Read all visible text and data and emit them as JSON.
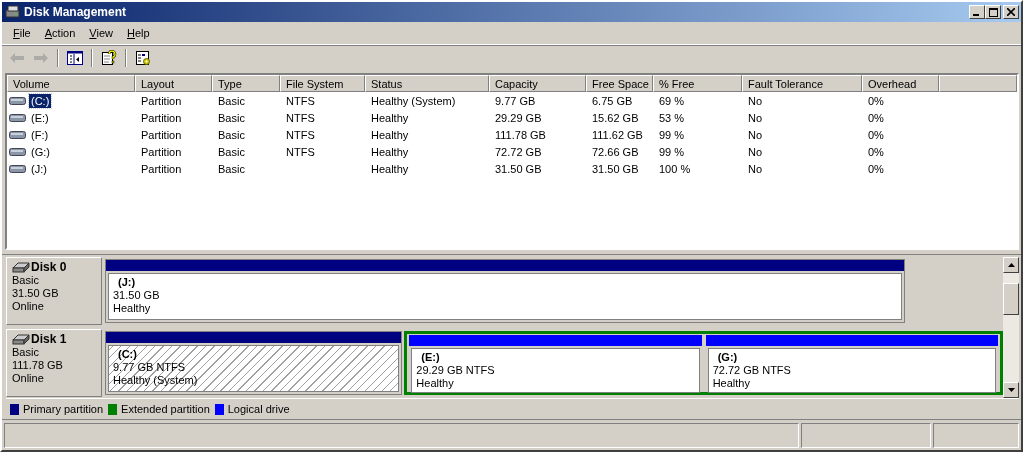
{
  "window": {
    "title": "Disk Management"
  },
  "menu": [
    {
      "label": "File"
    },
    {
      "label": "Action"
    },
    {
      "label": "View"
    },
    {
      "label": "Help"
    }
  ],
  "toolbar": [
    {
      "kind": "back",
      "disabled": true
    },
    {
      "kind": "forward",
      "disabled": true
    },
    {
      "kind": "sep"
    },
    {
      "kind": "tree",
      "disabled": false
    },
    {
      "kind": "sep"
    },
    {
      "kind": "help",
      "disabled": false
    },
    {
      "kind": "sep"
    },
    {
      "kind": "properties",
      "disabled": false
    }
  ],
  "table": {
    "columns": [
      "Volume",
      "Layout",
      "Type",
      "File System",
      "Status",
      "Capacity",
      "Free Space",
      "% Free",
      "Fault Tolerance",
      "Overhead"
    ],
    "rows": [
      {
        "selected": true,
        "cells": [
          "(C:)",
          "Partition",
          "Basic",
          "NTFS",
          "Healthy (System)",
          "9.77 GB",
          "6.75 GB",
          "69 %",
          "No",
          "0%"
        ]
      },
      {
        "selected": false,
        "cells": [
          "(E:)",
          "Partition",
          "Basic",
          "NTFS",
          "Healthy",
          "29.29 GB",
          "15.62 GB",
          "53 %",
          "No",
          "0%"
        ]
      },
      {
        "selected": false,
        "cells": [
          "(F:)",
          "Partition",
          "Basic",
          "NTFS",
          "Healthy",
          "111.78 GB",
          "111.62 GB",
          "99 %",
          "No",
          "0%"
        ]
      },
      {
        "selected": false,
        "cells": [
          "(G:)",
          "Partition",
          "Basic",
          "NTFS",
          "Healthy",
          "72.72 GB",
          "72.66 GB",
          "99 %",
          "No",
          "0%"
        ]
      },
      {
        "selected": false,
        "cells": [
          "(J:)",
          "Partition",
          "Basic",
          "",
          "Healthy",
          "31.50 GB",
          "31.50 GB",
          "100 %",
          "No",
          "0%"
        ]
      }
    ]
  },
  "disks": [
    {
      "name": "Disk 0",
      "type": "Basic",
      "size": "31.50 GB",
      "status": "Online",
      "partitions": [
        {
          "kind": "primary",
          "label": "(J:)",
          "size": "31.50 GB",
          "status": "Healthy",
          "selected": false
        }
      ]
    },
    {
      "name": "Disk 1",
      "type": "Basic",
      "size": "111.78 GB",
      "status": "Online",
      "partitions": [
        {
          "kind": "primary",
          "label": "(C:)",
          "size": "9.77 GB NTFS",
          "status": "Healthy (System)",
          "selected": true
        },
        {
          "kind": "extended",
          "children": [
            {
              "kind": "logical",
              "label": "(E:)",
              "size": "29.29 GB NTFS",
              "status": "Healthy",
              "selected": false
            },
            {
              "kind": "logical",
              "label": "(G:)",
              "size": "72.72 GB NTFS",
              "status": "Healthy",
              "selected": false
            }
          ]
        }
      ]
    }
  ],
  "legend": [
    {
      "label": "Primary partition",
      "color": "#000080"
    },
    {
      "label": "Extended partition",
      "color": "#008000"
    },
    {
      "label": "Logical drive",
      "color": "#0000ff"
    }
  ]
}
